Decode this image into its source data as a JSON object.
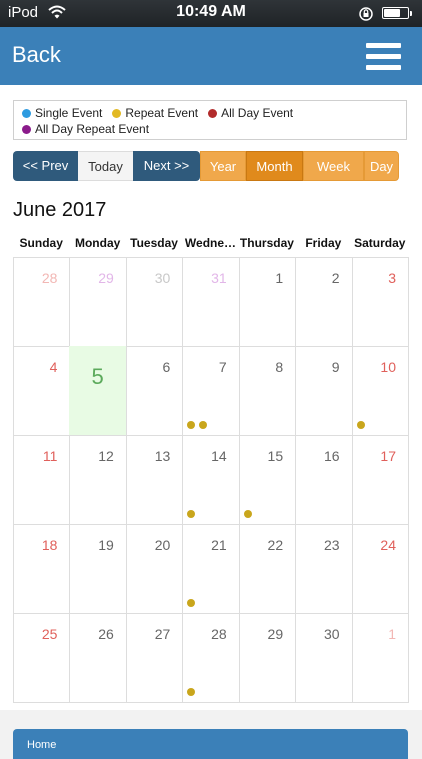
{
  "status_bar": {
    "carrier": "iPod",
    "time": "10:49 AM",
    "battery_level": 0.72
  },
  "nav": {
    "back_label": "Back",
    "menu_icon": "hamburger-menu-icon"
  },
  "legend": {
    "items": [
      {
        "label": "Single Event",
        "color": "#2e9be0"
      },
      {
        "label": "Repeat Event",
        "color": "#e2b923"
      },
      {
        "label": "All Day Event",
        "color": "#b22b2b"
      },
      {
        "label": "All Day Repeat Event",
        "color": "#8b1b8b"
      }
    ]
  },
  "controls": {
    "prev": "<< Prev",
    "today": "Today",
    "next": "Next >>",
    "views": [
      "Year",
      "Month",
      "Week",
      "Day"
    ],
    "active_view": "Month"
  },
  "calendar": {
    "title": "June 2017",
    "weekdays": [
      "Sunday",
      "Monday",
      "Tuesday",
      "Wedne…",
      "Thursday",
      "Friday",
      "Saturday"
    ],
    "event_dot_color": "#c9a61c",
    "weeks": [
      [
        {
          "n": "28",
          "s": "faint-red"
        },
        {
          "n": "29",
          "s": "faint-purple"
        },
        {
          "n": "30",
          "s": "faint"
        },
        {
          "n": "31",
          "s": "faint-purple"
        },
        {
          "n": "1",
          "s": "grey"
        },
        {
          "n": "2",
          "s": "grey"
        },
        {
          "n": "3",
          "s": "red"
        }
      ],
      [
        {
          "n": "4",
          "s": "red"
        },
        {
          "n": "5",
          "s": "today"
        },
        {
          "n": "6",
          "s": "grey"
        },
        {
          "n": "7",
          "s": "grey",
          "dots": 2
        },
        {
          "n": "8",
          "s": "grey"
        },
        {
          "n": "9",
          "s": "grey"
        },
        {
          "n": "10",
          "s": "red",
          "dots": 1
        }
      ],
      [
        {
          "n": "11",
          "s": "red"
        },
        {
          "n": "12",
          "s": "grey"
        },
        {
          "n": "13",
          "s": "grey"
        },
        {
          "n": "14",
          "s": "grey",
          "dots": 1
        },
        {
          "n": "15",
          "s": "grey",
          "dots": 1
        },
        {
          "n": "16",
          "s": "grey"
        },
        {
          "n": "17",
          "s": "red"
        }
      ],
      [
        {
          "n": "18",
          "s": "red"
        },
        {
          "n": "19",
          "s": "grey"
        },
        {
          "n": "20",
          "s": "grey"
        },
        {
          "n": "21",
          "s": "grey",
          "dots": 1
        },
        {
          "n": "22",
          "s": "grey"
        },
        {
          "n": "23",
          "s": "grey"
        },
        {
          "n": "24",
          "s": "red"
        }
      ],
      [
        {
          "n": "25",
          "s": "red"
        },
        {
          "n": "26",
          "s": "grey"
        },
        {
          "n": "27",
          "s": "grey"
        },
        {
          "n": "28",
          "s": "grey",
          "dots": 1
        },
        {
          "n": "29",
          "s": "grey"
        },
        {
          "n": "30",
          "s": "grey"
        },
        {
          "n": "1",
          "s": "faint-red"
        }
      ]
    ]
  },
  "footer": {
    "home_label": "Home"
  }
}
